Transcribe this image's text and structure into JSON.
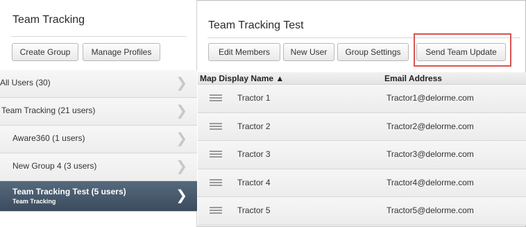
{
  "left_panel": {
    "title": "Team Tracking",
    "buttons": {
      "create_group": "Create Group",
      "manage_profiles": "Manage Profiles"
    },
    "groups": [
      {
        "label": "All Users (30)"
      },
      {
        "label": "Team Tracking (21 users)"
      },
      {
        "label": "Aware360 (1 users)"
      },
      {
        "label": "New Group 4 (3 users)"
      },
      {
        "label": "Team Tracking Test (5 users)",
        "sublabel": "Team Tracking",
        "selected": true
      }
    ]
  },
  "right_panel": {
    "title": "Team Tracking Test",
    "buttons": {
      "edit_members": "Edit Members",
      "new_user": "New User",
      "group_settings": "Group Settings",
      "send_team_update": "Send Team Update"
    },
    "table": {
      "columns": {
        "name": "Map Display Name ▲",
        "email": "Email Address"
      },
      "rows": [
        {
          "name": "Tractor 1",
          "email": "Tractor1@delorme.com"
        },
        {
          "name": "Tractor 2",
          "email": "Tractor2@delorme.com"
        },
        {
          "name": "Tractor 3",
          "email": "Tractor3@delorme.com"
        },
        {
          "name": "Tractor 4",
          "email": "Tractor4@delorme.com"
        },
        {
          "name": "Tractor 5",
          "email": "Tractor5@delorme.com"
        }
      ]
    }
  },
  "icons": {
    "chevron": "chevron-right-icon",
    "drag_handle": "drag-handle-icon"
  },
  "colors": {
    "selected_bg": "#3b4c5e",
    "highlight_border": "#d9534f"
  }
}
